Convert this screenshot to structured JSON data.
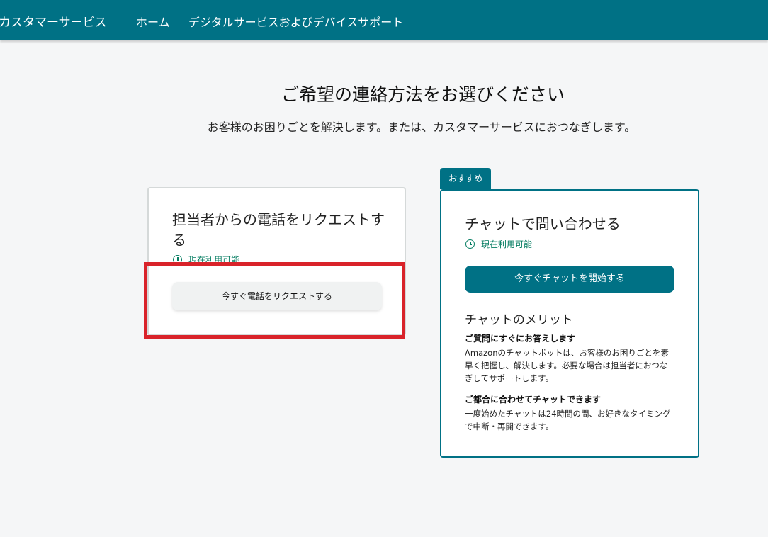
{
  "header": {
    "brand": "カスタマーサービス",
    "nav_home": "ホーム",
    "nav_digital": "デジタルサービスおよびデバイスサポート"
  },
  "main": {
    "title": "ご希望の連絡方法をお選びください",
    "subtitle": "お客様のお困りごとを解決します。または、カスタマーサービスにおつなぎします。"
  },
  "callback_card": {
    "title": "担当者からの電話をリクエストする",
    "availability": "現在利用可能",
    "button": "今すぐ電話をリクエストする"
  },
  "chat_card": {
    "badge": "おすすめ",
    "title": "チャットで問い合わせる",
    "availability": "現在利用可能",
    "button": "今すぐチャットを開始する",
    "benefits_title": "チャットのメリット",
    "benefits": [
      {
        "heading": "ご質問にすぐにお答えします",
        "text": "Amazonのチャットボットは、お客様のお困りごとを素早く把握し、解決します。必要な場合は担当者におつなぎしてサポートします。"
      },
      {
        "heading": "ご都合に合わせてチャットできます",
        "text": "一度始めたチャットは24時間の間、お好きなタイミングで中断・再開できます。"
      }
    ]
  },
  "colors": {
    "brand_teal": "#007185",
    "available_green": "#067d62",
    "highlight_red": "#d9232a"
  }
}
